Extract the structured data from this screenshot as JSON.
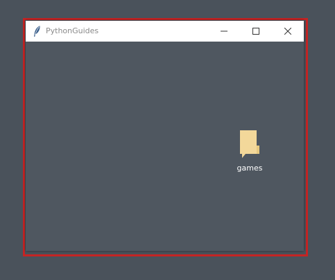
{
  "window": {
    "title": "PythonGuides",
    "app_icon": "feather-icon",
    "controls": {
      "minimize_icon": "minimize-icon",
      "maximize_icon": "maximize-icon",
      "close_icon": "close-icon"
    }
  },
  "content": {
    "items": [
      {
        "label": "games",
        "icon": "folder-icon",
        "icon_color": "#f3d89a"
      }
    ]
  },
  "colors": {
    "desktop_bg": "#4a525b",
    "window_bg": "#4f5760",
    "titlebar_bg": "#ffffff",
    "highlight_border": "#c42424"
  }
}
